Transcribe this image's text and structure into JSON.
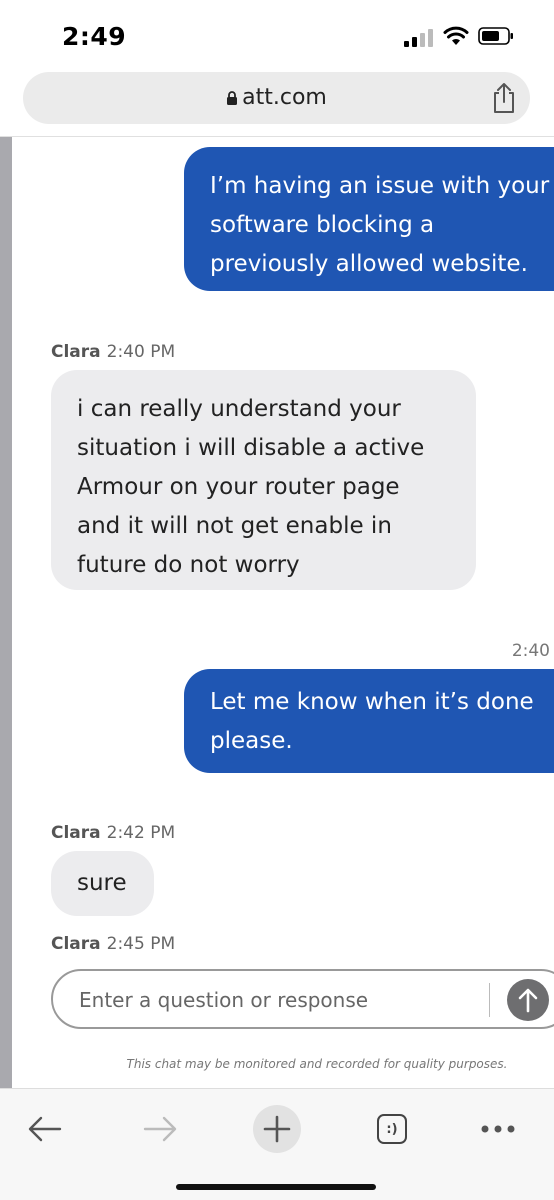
{
  "status_bar": {
    "time": "2:49"
  },
  "browser": {
    "url": "att.com"
  },
  "chat": {
    "messages": [
      {
        "role": "user",
        "text": "I’m having an issue with your software blocking a previously allowed website."
      },
      {
        "role": "agent",
        "sender": "Clara",
        "time": "2:40 PM",
        "text": "i can really understand your situation i will disable a active Armour on your router page and it will not get enable in future do not worry"
      },
      {
        "role": "user",
        "time": "2:40",
        "text": "Let me know when it’s done please."
      },
      {
        "role": "agent",
        "sender": "Clara",
        "time": "2:42 PM",
        "text": "sure"
      },
      {
        "role": "agent",
        "sender": "Clara",
        "time": "2:45 PM",
        "text": ""
      }
    ],
    "input_placeholder": "Enter a question or response",
    "disclaimer": "This chat may be monitored and recorded for quality purposes."
  },
  "toolbar": {
    "tabs_label": ":)"
  },
  "colors": {
    "user_bubble": "#1f56b3",
    "agent_bubble": "#ececee",
    "send_button": "#6e6e70"
  }
}
